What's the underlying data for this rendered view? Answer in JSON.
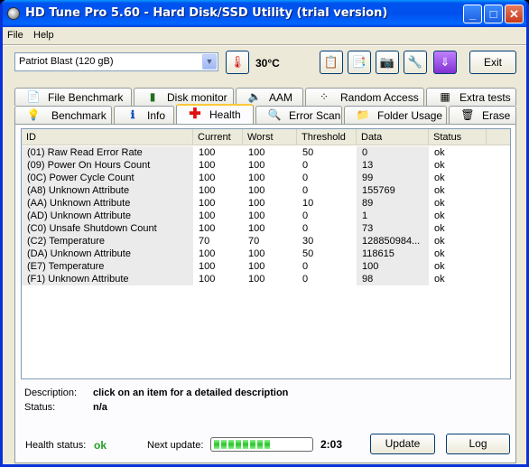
{
  "window": {
    "title": "HD Tune Pro 5.60 - Hard Disk/SSD Utility (trial version)"
  },
  "menu": {
    "file": "File",
    "help": "Help"
  },
  "toolbar": {
    "drive": "Patriot Blast (120 gB)",
    "temperature": "30°C",
    "exit_label": "Exit"
  },
  "tabs_row1": [
    {
      "label": "File Benchmark",
      "icon": "file-benchmark-icon"
    },
    {
      "label": "Disk monitor",
      "icon": "disk-monitor-icon"
    },
    {
      "label": "AAM",
      "icon": "speaker-icon"
    },
    {
      "label": "Random Access",
      "icon": "random-access-icon"
    },
    {
      "label": "Extra tests",
      "icon": "extra-tests-icon"
    }
  ],
  "tabs_row2": [
    {
      "label": "Benchmark",
      "icon": "lightbulb-icon"
    },
    {
      "label": "Info",
      "icon": "info-icon"
    },
    {
      "label": "Health",
      "icon": "health-cross-icon"
    },
    {
      "label": "Error Scan",
      "icon": "magnifier-icon"
    },
    {
      "label": "Folder Usage",
      "icon": "folder-icon"
    },
    {
      "label": "Erase",
      "icon": "trash-icon"
    }
  ],
  "active_tab": "Health",
  "table": {
    "columns": [
      "ID",
      "Current",
      "Worst",
      "Threshold",
      "Data",
      "Status"
    ],
    "rows": [
      [
        "(01) Raw Read Error Rate",
        "100",
        "100",
        "50",
        "0",
        "ok"
      ],
      [
        "(09) Power On Hours Count",
        "100",
        "100",
        "0",
        "13",
        "ok"
      ],
      [
        "(0C) Power Cycle Count",
        "100",
        "100",
        "0",
        "99",
        "ok"
      ],
      [
        "(A8) Unknown Attribute",
        "100",
        "100",
        "0",
        "155769",
        "ok"
      ],
      [
        "(AA) Unknown Attribute",
        "100",
        "100",
        "10",
        "89",
        "ok"
      ],
      [
        "(AD) Unknown Attribute",
        "100",
        "100",
        "0",
        "1",
        "ok"
      ],
      [
        "(C0) Unsafe Shutdown Count",
        "100",
        "100",
        "0",
        "73",
        "ok"
      ],
      [
        "(C2) Temperature",
        "70",
        "70",
        "30",
        "128850984...",
        "ok"
      ],
      [
        "(DA) Unknown Attribute",
        "100",
        "100",
        "50",
        "118615",
        "ok"
      ],
      [
        "(E7) Temperature",
        "100",
        "100",
        "0",
        "100",
        "ok"
      ],
      [
        "(F1) Unknown Attribute",
        "100",
        "100",
        "0",
        "98",
        "ok"
      ]
    ]
  },
  "description": {
    "label": "Description:",
    "value": "click on an item for a detailed description",
    "status_label": "Status:",
    "status_value": "n/a"
  },
  "footer": {
    "health_label": "Health status:",
    "health_value": "ok",
    "health_color": "#21a121",
    "next_label": "Next update:",
    "progress_fraction": 0.6,
    "countdown": "2:03",
    "update_label": "Update",
    "log_label": "Log"
  }
}
